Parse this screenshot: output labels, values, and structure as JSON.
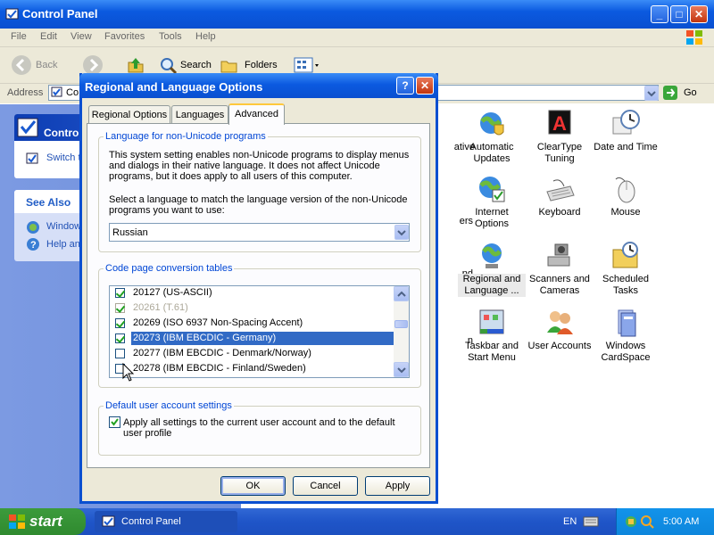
{
  "window": {
    "title": "Control Panel",
    "menu": [
      "File",
      "Edit",
      "View",
      "Favorites",
      "Tools",
      "Help"
    ],
    "toolbar": {
      "back": "Back",
      "search": "Search",
      "folders": "Folders"
    },
    "address_label": "Address",
    "address_value": "Co",
    "go_label": "Go"
  },
  "left_pane": {
    "control_panel_title": "Contro",
    "switch_link": "Switch t",
    "see_also_title": "See Also",
    "see_also_items": [
      "Window",
      "Help an"
    ]
  },
  "content": {
    "items": [
      {
        "label": "ative",
        "icon": "partial-icon"
      },
      {
        "label": "Automatic Updates",
        "icon": "globe-shield-icon"
      },
      {
        "label": "ClearType Tuning",
        "icon": "cleartype-icon"
      },
      {
        "label": "Date and Time",
        "icon": "clock-icon"
      },
      {
        "label": "ers",
        "icon": "partial-icon"
      },
      {
        "label": "Internet Options",
        "icon": "internet-options-icon"
      },
      {
        "label": "Keyboard",
        "icon": "keyboard-icon"
      },
      {
        "label": "Mouse",
        "icon": "mouse-icon"
      },
      {
        "label": "nd",
        "icon": "partial-icon"
      },
      {
        "label": "Regional and Language ...",
        "icon": "globe-icon"
      },
      {
        "label": "Scanners and Cameras",
        "icon": "scanner-icon"
      },
      {
        "label": "Scheduled Tasks",
        "icon": "scheduled-tasks-icon"
      },
      {
        "label": "n",
        "icon": "partial-icon"
      },
      {
        "label": "Taskbar and Start Menu",
        "icon": "taskbar-icon"
      },
      {
        "label": "User Accounts",
        "icon": "users-icon"
      },
      {
        "label": "Windows CardSpace",
        "icon": "cardspace-icon"
      }
    ]
  },
  "dialog": {
    "title": "Regional and Language Options",
    "tabs": [
      "Regional Options",
      "Languages",
      "Advanced"
    ],
    "active_tab": "Advanced",
    "nonunicode": {
      "title": "Language for non-Unicode programs",
      "desc1": "This system setting enables non-Unicode programs to display menus",
      "desc2": "and dialogs in their native language. It does not affect Unicode",
      "desc3": "programs, but it does apply to all users of this computer.",
      "prompt1": "Select a language to match the language version of the non-Unicode",
      "prompt2": "programs you want to use:",
      "selected_language": "Russian"
    },
    "codepage": {
      "title": "Code page conversion tables",
      "rows": [
        {
          "label": "20127 (US-ASCII)",
          "checked": true,
          "state": "normal"
        },
        {
          "label": "20261 (T.61)",
          "checked": true,
          "state": "dim"
        },
        {
          "label": "20269 (ISO 6937 Non-Spacing Accent)",
          "checked": true,
          "state": "normal"
        },
        {
          "label": "20273 (IBM EBCDIC - Germany)",
          "checked": true,
          "state": "selected"
        },
        {
          "label": "20277 (IBM EBCDIC - Denmark/Norway)",
          "checked": false,
          "state": "normal"
        },
        {
          "label": "20278 (IBM EBCDIC - Finland/Sweden)",
          "checked": false,
          "state": "normal"
        }
      ]
    },
    "default_user": {
      "title": "Default user account settings",
      "checkbox_line1": "Apply all settings to the current user account and to the default",
      "checkbox_line2": "user profile",
      "checked": true
    },
    "buttons": {
      "ok": "OK",
      "cancel": "Cancel",
      "apply": "Apply"
    }
  },
  "taskbar": {
    "start": "start",
    "task": "Control Panel",
    "lang": "EN",
    "clock": "5:00 AM"
  }
}
